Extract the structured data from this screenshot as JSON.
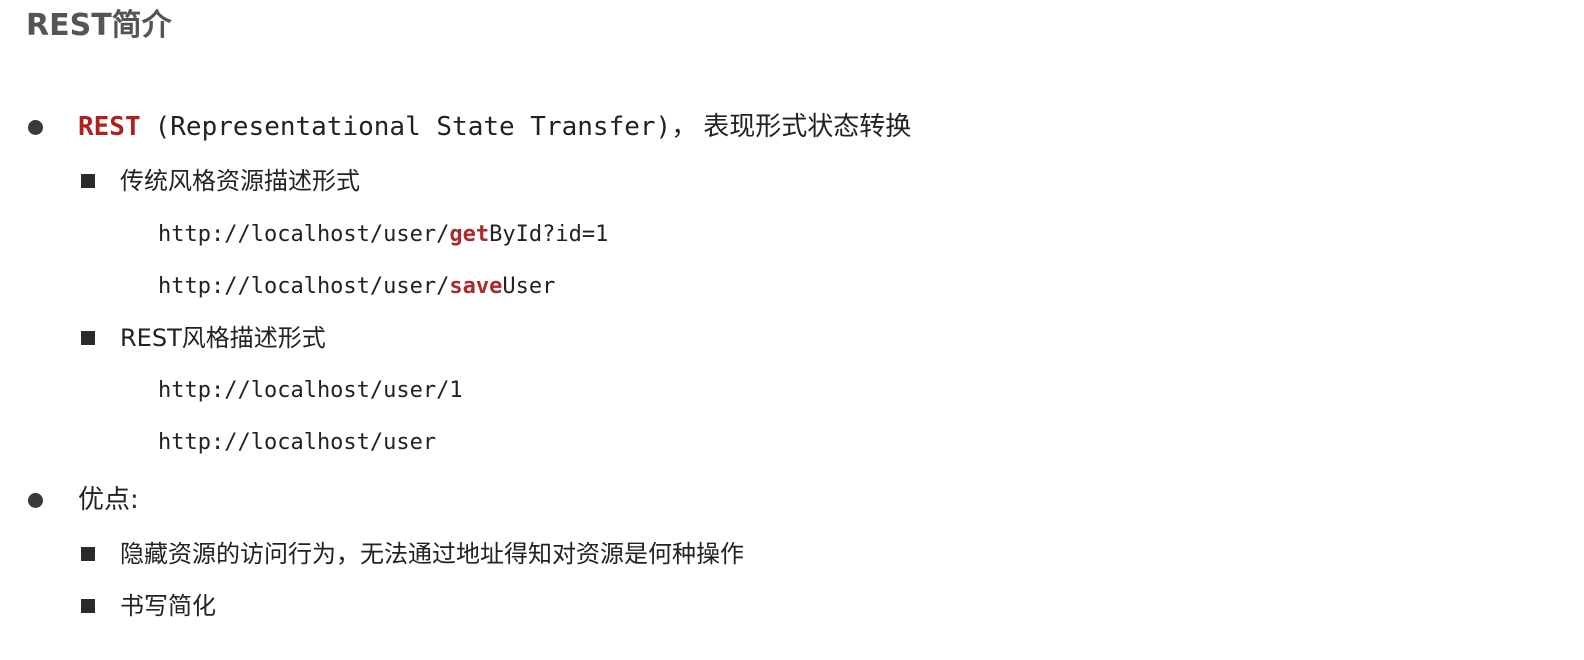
{
  "title": "REST简介",
  "colors": {
    "title": "#555555",
    "accent_red": "#a82a2a",
    "text": "#222222"
  },
  "section1": {
    "keyword": "REST",
    "paren_text": "(Representational State Transfer)",
    "comma": "，",
    "desc": "表现形式状态转换",
    "traditional": {
      "label": "传统风格资源描述形式",
      "urls": [
        {
          "prefix": "http://localhost/user/",
          "highlight": "get",
          "suffix": "ById?id=1"
        },
        {
          "prefix": "http://localhost/user/",
          "highlight": "save",
          "suffix": "User"
        }
      ]
    },
    "rest_style": {
      "label": "REST风格描述形式",
      "urls": [
        "http://localhost/user/1",
        "http://localhost/user"
      ]
    }
  },
  "section2": {
    "label": "优点:",
    "items": [
      "隐藏资源的访问行为，无法通过地址得知对资源是何种操作",
      "书写简化"
    ]
  }
}
